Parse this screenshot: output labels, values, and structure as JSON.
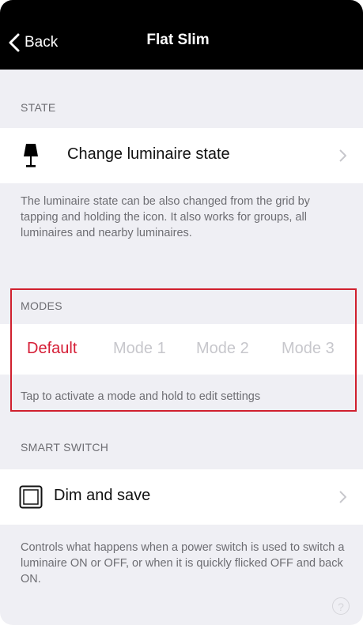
{
  "nav": {
    "back_label": "Back",
    "title": "Flat Slim"
  },
  "state": {
    "header": "STATE",
    "item_label": "Change luminaire state",
    "item_icon": "lamp-icon",
    "footnote": "The luminaire state can be also changed from the grid by tapping and holding the icon. It also works for groups, all luminaires and nearby luminaires."
  },
  "modes": {
    "header": "MODES",
    "items": [
      {
        "label": "Default",
        "active": true
      },
      {
        "label": "Mode 1",
        "active": false
      },
      {
        "label": "Mode 2",
        "active": false
      },
      {
        "label": "Mode 3",
        "active": false
      }
    ],
    "footnote": "Tap to activate a mode and hold to edit settings",
    "highlight_color": "#d0202e",
    "active_color": "#d51d35"
  },
  "smart_switch": {
    "header": "SMART SWITCH",
    "item_label": "Dim and save",
    "item_icon": "checkbox-icon",
    "footnote": "Controls what happens when a power switch is used to switch a luminaire ON or OFF, or when it is quickly flicked OFF and back ON."
  },
  "help": {
    "icon": "help-icon",
    "glyph": "?"
  }
}
